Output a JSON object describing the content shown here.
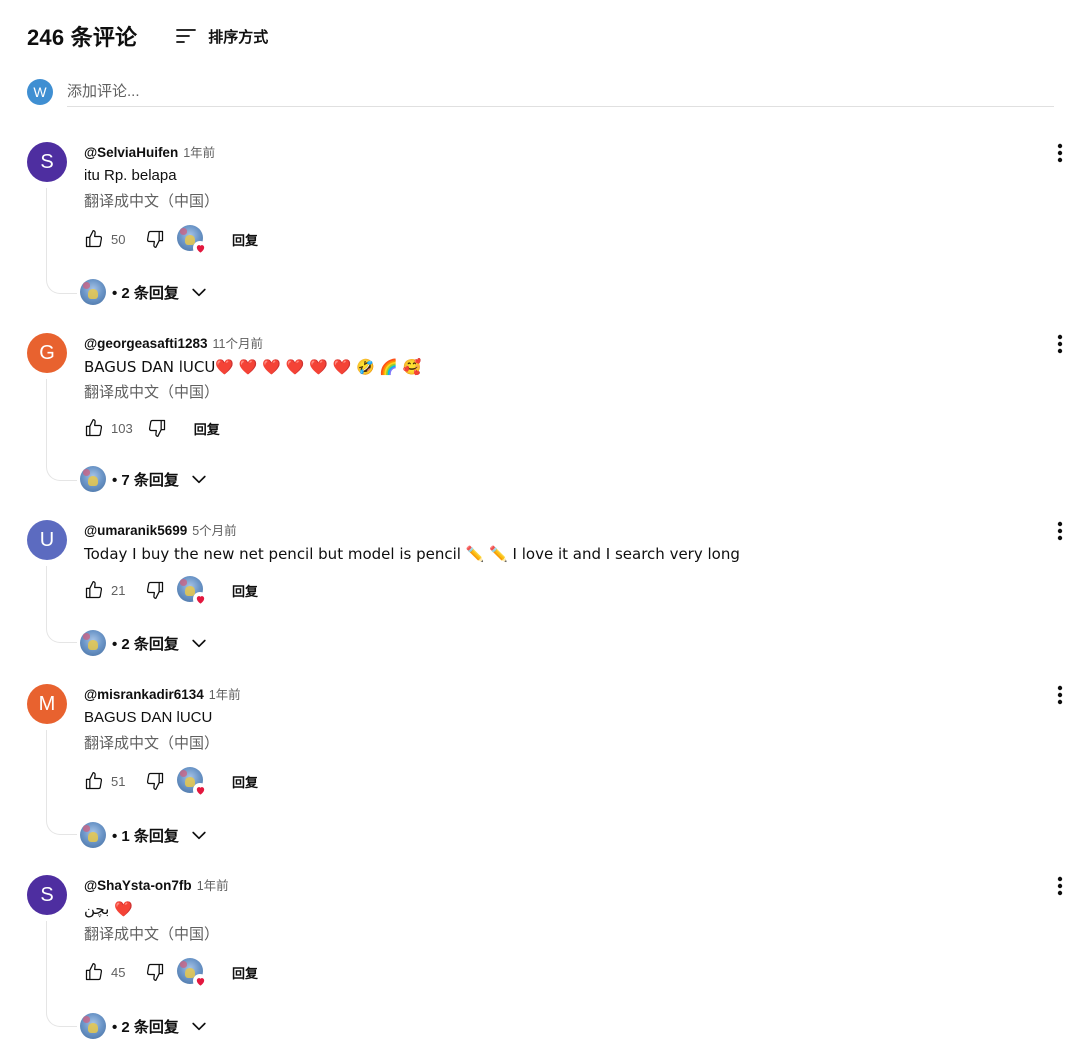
{
  "header": {
    "comment_count": "246 条评论",
    "sort_label": "排序方式"
  },
  "add_comment": {
    "avatar_letter": "W",
    "avatar_color": "#3f8fd2",
    "placeholder": "添加评论..."
  },
  "comments": [
    {
      "avatar_letter": "S",
      "avatar_color": "#4e2ea0",
      "author": "@SelviaHuifen",
      "time": "1年前",
      "text": "itu  Rp. belapa",
      "translate": "翻译成中文（中国）",
      "likes": "50",
      "creator_heart": true,
      "reply_label": "回复",
      "replies": "• 2 条回复"
    },
    {
      "avatar_letter": "G",
      "avatar_color": "#e8622f",
      "author": "@georgeasafti1283",
      "time": "11个月前",
      "text": "BAGUS DAN lUCU❤️ ❤️ ❤️ ❤️ ❤️ ❤️ 🤣 🌈 🥰",
      "translate": "翻译成中文（中国）",
      "likes": "103",
      "creator_heart": false,
      "reply_label": "回复",
      "replies": "• 7 条回复"
    },
    {
      "avatar_letter": "U",
      "avatar_color": "#5c6bc0",
      "author": "@umaranik5699",
      "time": "5个月前",
      "text": "Today I buy the new net pencil but model is pencil ✏️ ✏️  I love it and I search very long",
      "translate": "",
      "likes": "21",
      "creator_heart": true,
      "reply_label": "回复",
      "replies": "• 2 条回复"
    },
    {
      "avatar_letter": "M",
      "avatar_color": "#e8622f",
      "author": "@misrankadir6134",
      "time": "1年前",
      "text": "BAGUS DAN lUCU",
      "translate": "翻译成中文（中国）",
      "likes": "51",
      "creator_heart": true,
      "reply_label": "回复",
      "replies": "• 1 条回复"
    },
    {
      "avatar_letter": "S",
      "avatar_color": "#4e2ea0",
      "author": "@ShaYsta-on7fb",
      "time": "1年前",
      "text": "بچن ❤️",
      "translate": "翻译成中文（中国）",
      "likes": "45",
      "creator_heart": true,
      "reply_label": "回复",
      "replies": "• 2 条回复"
    }
  ],
  "icons": {
    "sort": "sort-icon",
    "like": "thumb-up-icon",
    "dislike": "thumb-down-icon",
    "more": "more-vertical-icon",
    "chevron": "chevron-down-icon",
    "heart": "heart-icon"
  }
}
